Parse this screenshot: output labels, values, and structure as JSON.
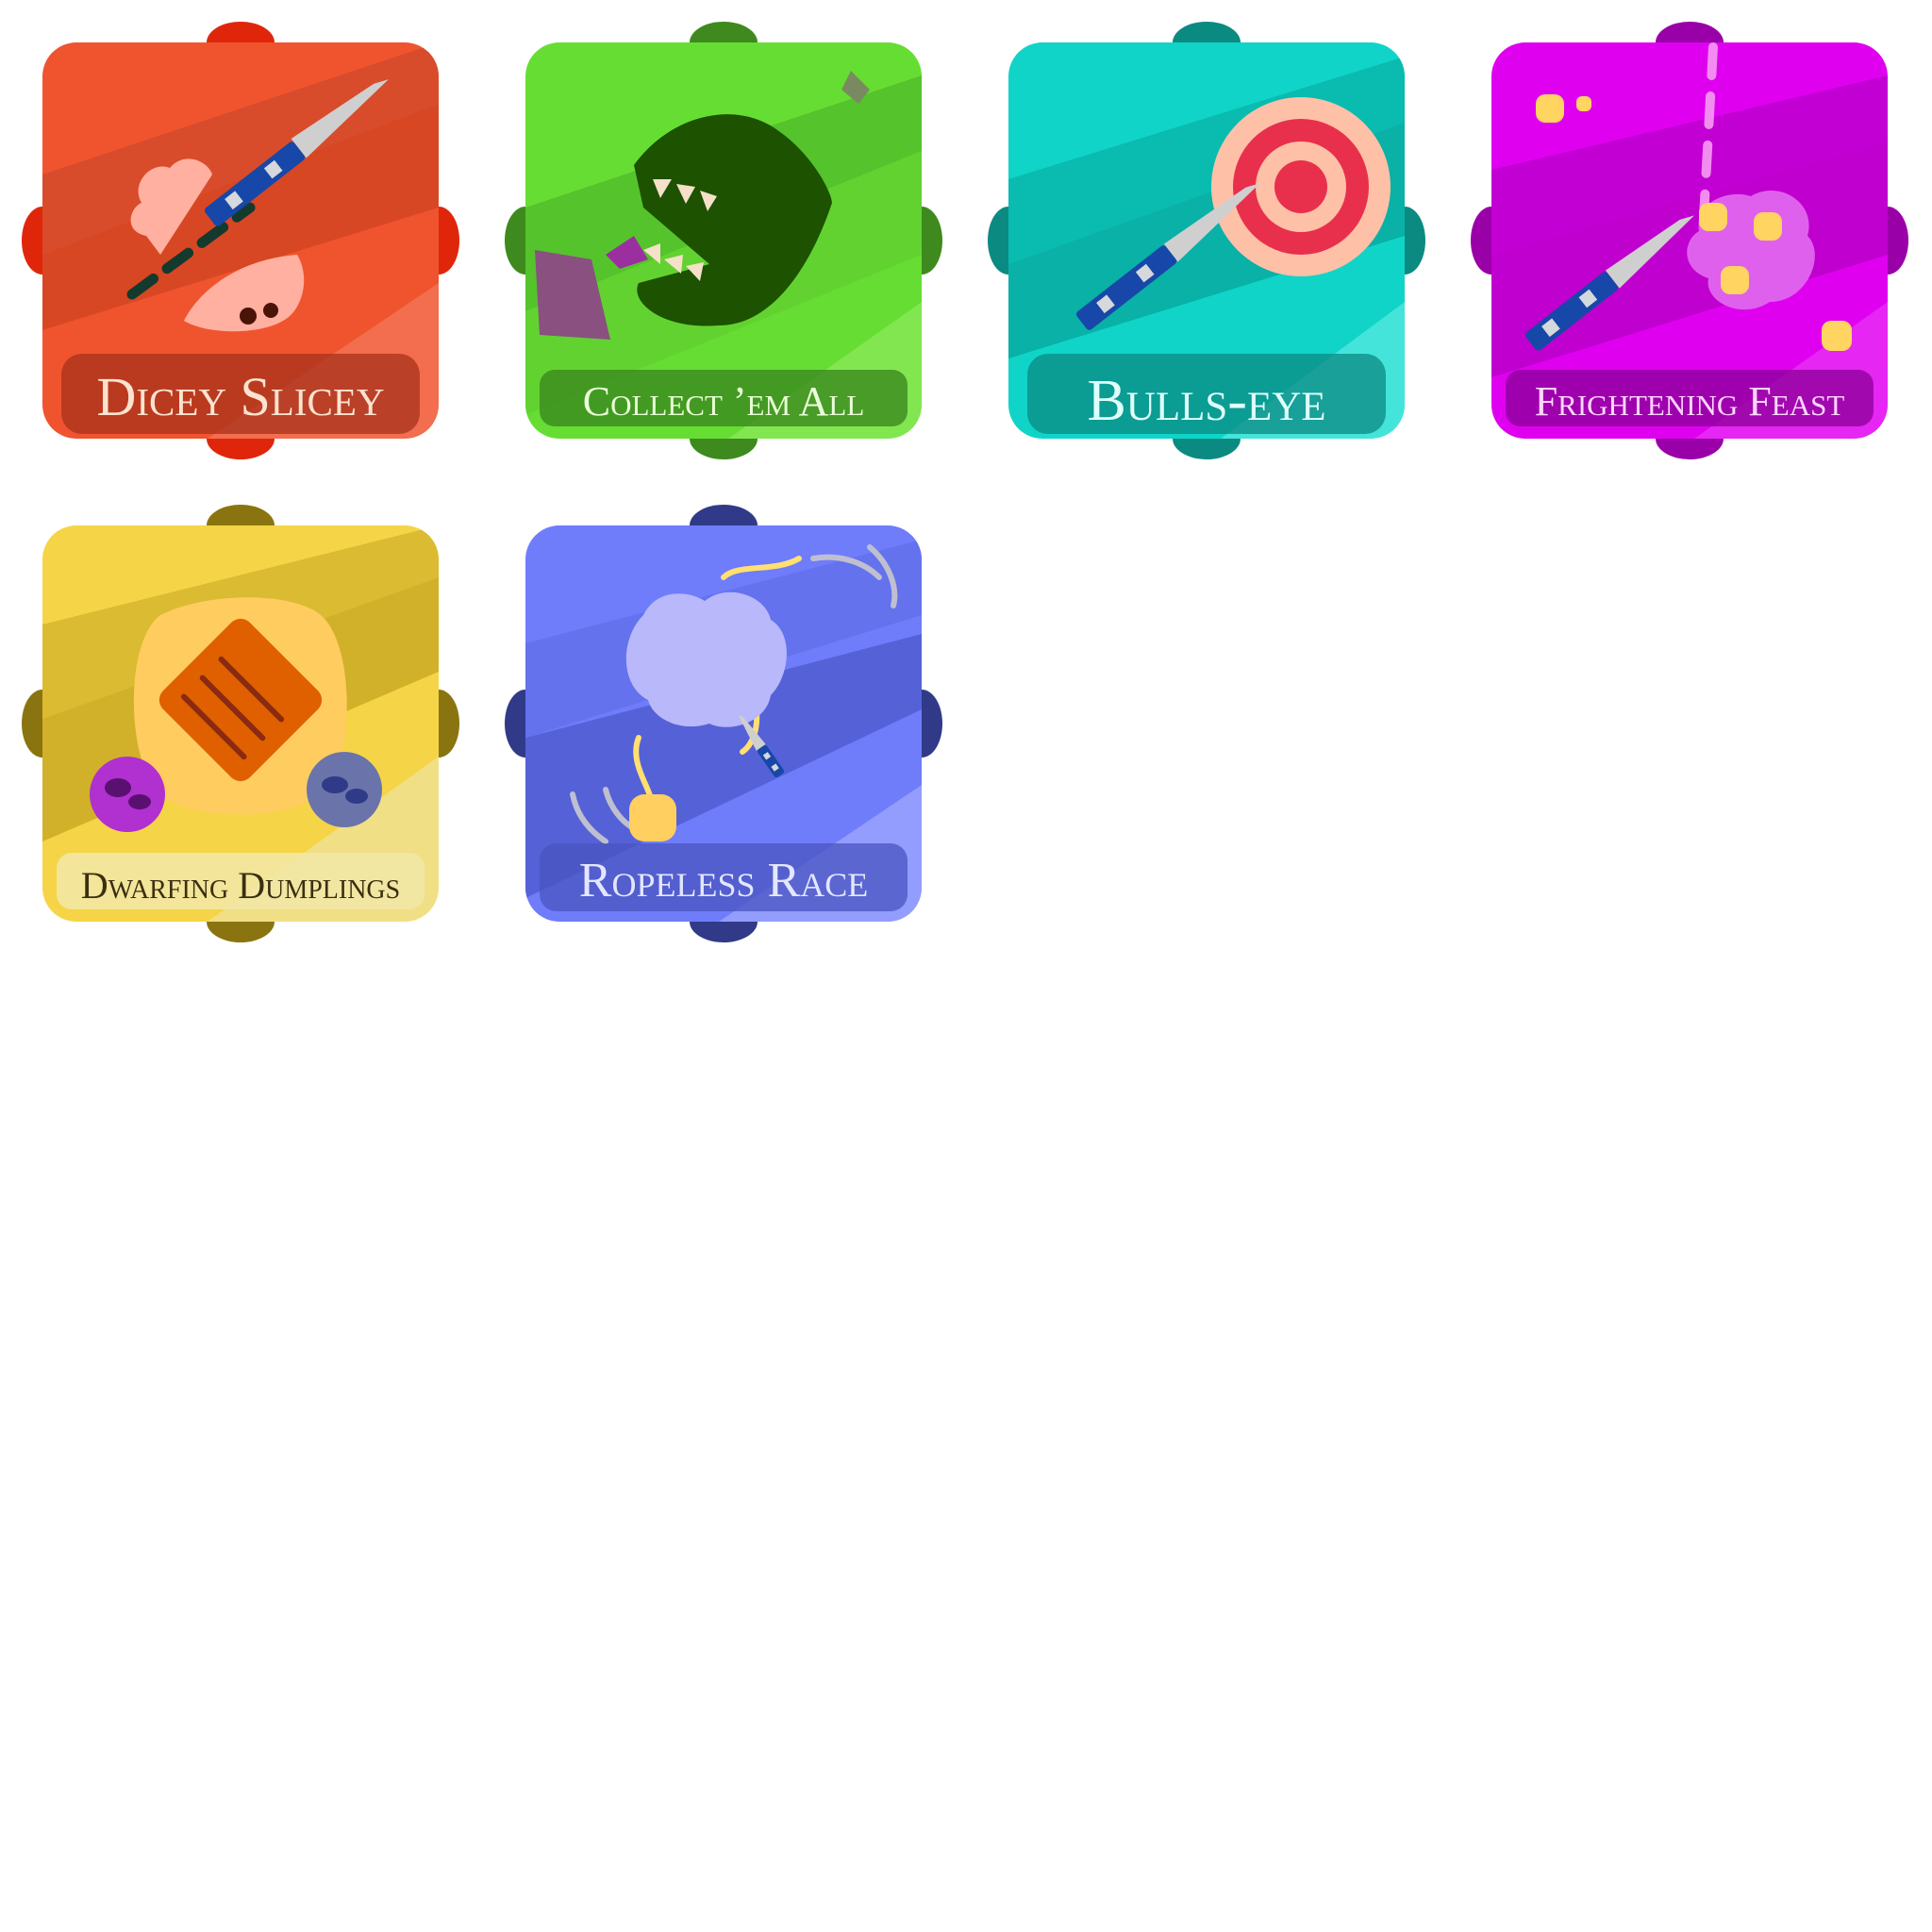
{
  "badges": [
    {
      "title": "Dicey Slicey",
      "base": "#f0542e",
      "knob": "#e0260a",
      "title_color": "#fde3cf"
    },
    {
      "title": "Collect ’em All",
      "base": "#66dd33",
      "knob": "#3e8a1e",
      "title_color": "#eaffd9"
    },
    {
      "title": "Bulls-eye",
      "base": "#10d4c8",
      "knob": "#0b8a82",
      "title_color": "#dffffb"
    },
    {
      "title": "Frightening Feast",
      "base": "#e000f0",
      "knob": "#9a00a8",
      "title_color": "#ffd6ff"
    },
    {
      "title": "Dwarfing Dumplings",
      "base": "#f5d547",
      "knob": "#8a7410",
      "title_color": "#3b2f10"
    },
    {
      "title": "Ropeless Race",
      "base": "#6f7dfb",
      "knob": "#303a88",
      "title_color": "#e3e6ff"
    }
  ]
}
